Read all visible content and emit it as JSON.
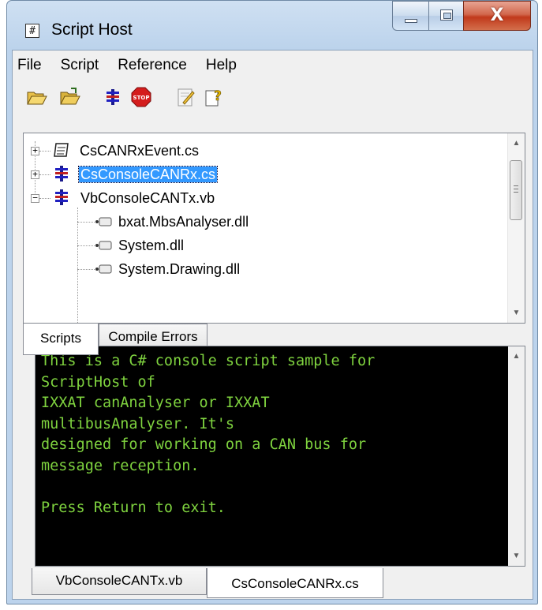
{
  "window": {
    "title": "Script Host",
    "app_icon_glyph": "#",
    "close_glyph": "X"
  },
  "menu": {
    "items": [
      "File",
      "Script",
      "Reference",
      "Help"
    ]
  },
  "toolbar": {
    "buttons": [
      {
        "icon": "open-folder-icon"
      },
      {
        "icon": "open-folder-alt-icon"
      },
      {
        "icon": "run-script-icon"
      },
      {
        "icon": "stop-icon"
      },
      {
        "icon": "edit-script-icon"
      },
      {
        "icon": "help-icon"
      }
    ]
  },
  "tree": {
    "nodes": [
      {
        "label": "CsCANRxEvent.cs",
        "expander": "+",
        "icon": "script-page-icon",
        "selected": false
      },
      {
        "label": "CsConsoleCANRx.cs",
        "expander": "+",
        "icon": "bus-script-icon",
        "selected": true
      },
      {
        "label": "VbConsoleCANTx.vb",
        "expander": "−",
        "icon": "bus-script-icon",
        "selected": false
      },
      {
        "label": "bxat.MbsAnalyser.dll",
        "icon": "reference-icon"
      },
      {
        "label": "System.dll",
        "icon": "reference-icon"
      },
      {
        "label": "System.Drawing.dll",
        "icon": "reference-icon"
      }
    ]
  },
  "top_tabs": [
    {
      "label": "Scripts",
      "active": true
    },
    {
      "label": "Compile Errors",
      "active": false
    }
  ],
  "console": {
    "lines": [
      "This is a C# console script sample for",
      "ScriptHost of",
      "IXXAT canAnalyser or IXXAT",
      "multibusAnalyser. It's",
      "designed for working on a CAN bus for",
      "message reception.",
      "",
      "Press Return to exit."
    ],
    "text_color": "#7fd33f",
    "background": "#000000"
  },
  "bottom_tabs": [
    {
      "label": "VbConsoleCANTx.vb",
      "active": false
    },
    {
      "label": "CsConsoleCANRx.cs",
      "active": true
    }
  ],
  "scroll_arrows": {
    "up": "▲",
    "down": "▼"
  }
}
